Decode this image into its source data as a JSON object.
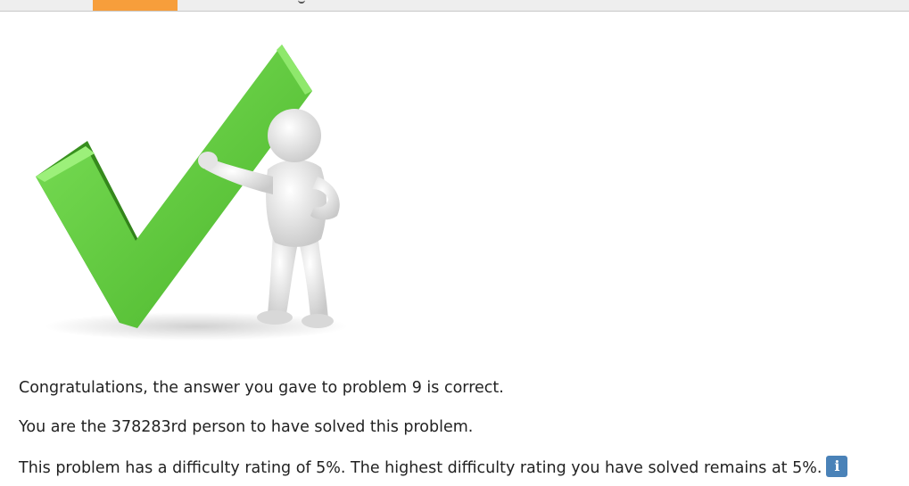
{
  "messages": {
    "congrats": "Congratulations, the answer you gave to problem 9 is correct.",
    "solver_rank": "You are the 378283rd person to have solved this problem.",
    "difficulty": "This problem has a difficulty rating of 5%. The highest difficulty rating you have solved remains at 5%."
  },
  "info_icon": {
    "glyph": "i",
    "icon": "info-icon"
  },
  "colors": {
    "active_tab": "#f79e3b",
    "checkmark_green": "#5cc63a",
    "info_blue": "#4a82b8"
  }
}
